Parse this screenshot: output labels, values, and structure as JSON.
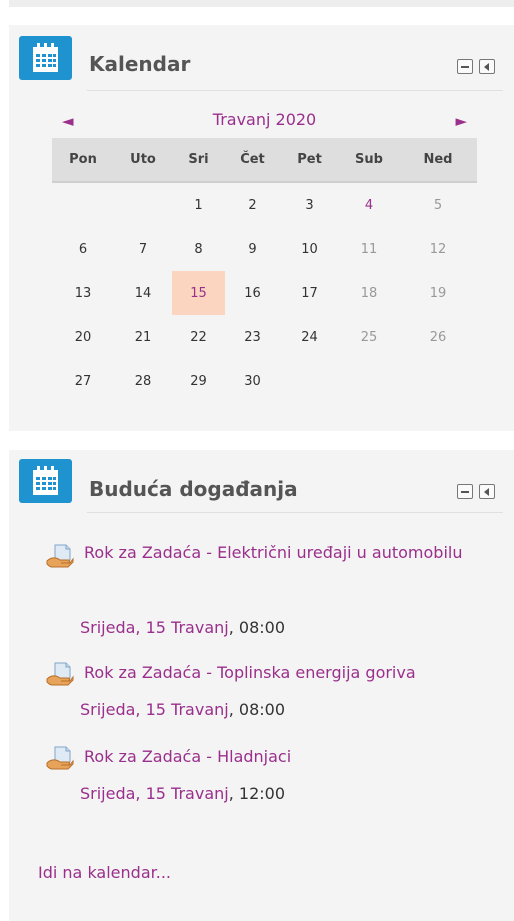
{
  "calendar_block": {
    "title": "Kalendar",
    "month_label": "Travanj 2020",
    "prev_glyph": "◄",
    "next_glyph": "►",
    "weekdays": [
      "Pon",
      "Uto",
      "Sri",
      "Čet",
      "Pet",
      "Sub",
      "Ned"
    ],
    "weeks": [
      [
        "",
        "",
        "1",
        "2",
        "3",
        "4",
        "5"
      ],
      [
        "6",
        "7",
        "8",
        "9",
        "10",
        "11",
        "12"
      ],
      [
        "13",
        "14",
        "15",
        "16",
        "17",
        "18",
        "19"
      ],
      [
        "20",
        "21",
        "22",
        "23",
        "24",
        "25",
        "26"
      ],
      [
        "27",
        "28",
        "29",
        "30",
        "",
        "",
        ""
      ]
    ],
    "today": "15"
  },
  "events_block": {
    "title": "Buduća događanja",
    "events": [
      {
        "title": "Rok za Zadaća - Električni uređaji u automobilu",
        "date_link": "Srijeda, 15 Travanj",
        "time": ", 08:00"
      },
      {
        "title": "Rok za Zadaća - Toplinska energija goriva",
        "date_link": "Srijeda, 15 Travanj",
        "time": ", 08:00"
      },
      {
        "title": "Rok za Zadaća - Hladnjaci",
        "date_link": "Srijeda, 15 Travanj",
        "time": ", 12:00"
      }
    ],
    "goto_link": "Idi na kalendar..."
  },
  "colors": {
    "accent": "#9a2f8c",
    "icon_blue": "#1f93d0",
    "today_bg": "#fbd5bf"
  },
  "icons": {
    "block_icon": "calendar-icon",
    "event_icon": "assignment-icon"
  }
}
